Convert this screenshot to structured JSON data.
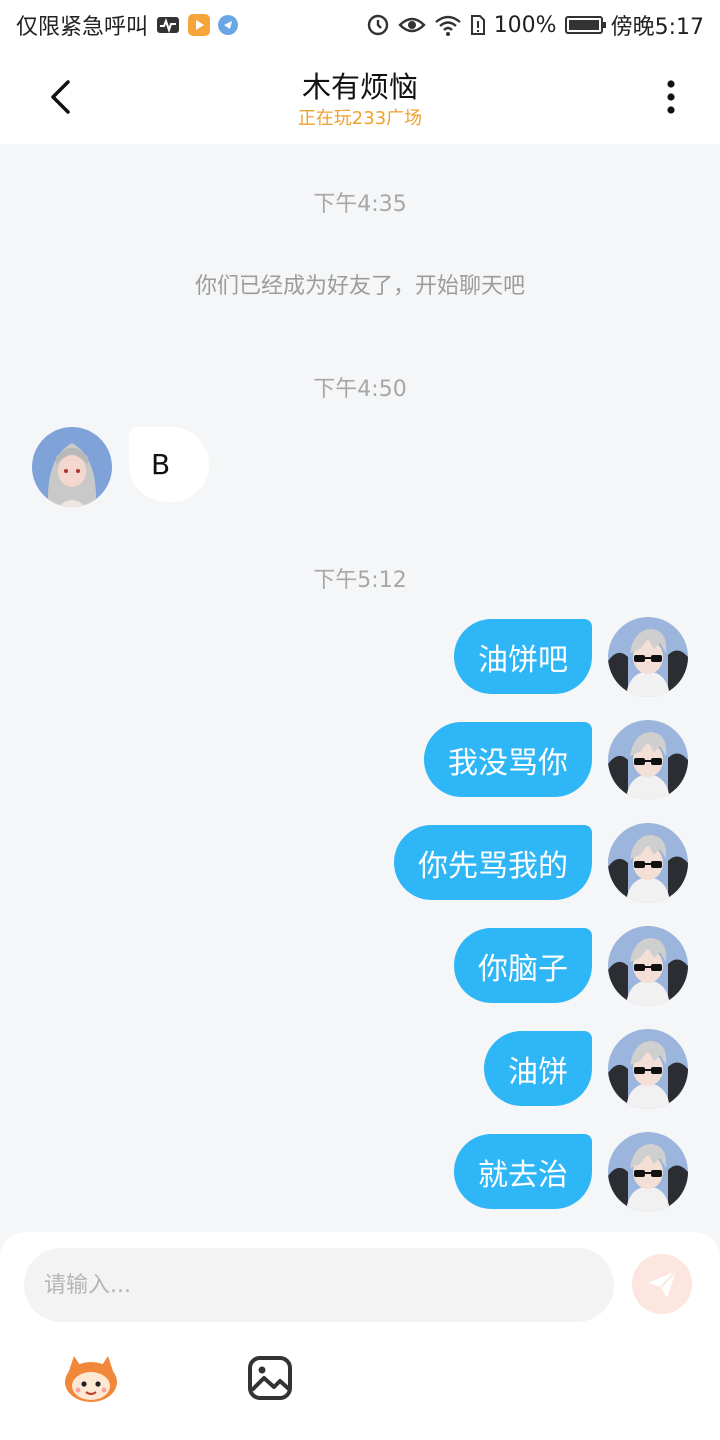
{
  "status_bar": {
    "carrier_text": "仅限紧急呼叫",
    "battery_text": "100%",
    "time_text": "傍晚5:17",
    "icons": [
      "activity-icon",
      "video-app-icon",
      "browser-app-icon",
      "data-saver-icon",
      "eye-icon",
      "wifi-icon",
      "sim-alert-icon",
      "battery-icon"
    ]
  },
  "header": {
    "title": "木有烦恼",
    "subtitle": "正在玩233广场",
    "subtitle_color": "#f0a030"
  },
  "chat": {
    "timestamps": [
      "下午4:35",
      "下午4:50",
      "下午5:12"
    ],
    "system_message": "你们已经成为好友了，开始聊天吧",
    "incoming": [
      {
        "text": "B"
      }
    ],
    "outgoing": [
      {
        "text": "油饼吧"
      },
      {
        "text": "我没骂你"
      },
      {
        "text": "你先骂我的"
      },
      {
        "text": "你脑子"
      },
      {
        "text": "油饼"
      },
      {
        "text": "就去治"
      }
    ],
    "outgoing_bubble_color": "#2fb6f6"
  },
  "composer": {
    "placeholder": "请输入...",
    "value": "",
    "send_button_color": "#fde6df"
  }
}
